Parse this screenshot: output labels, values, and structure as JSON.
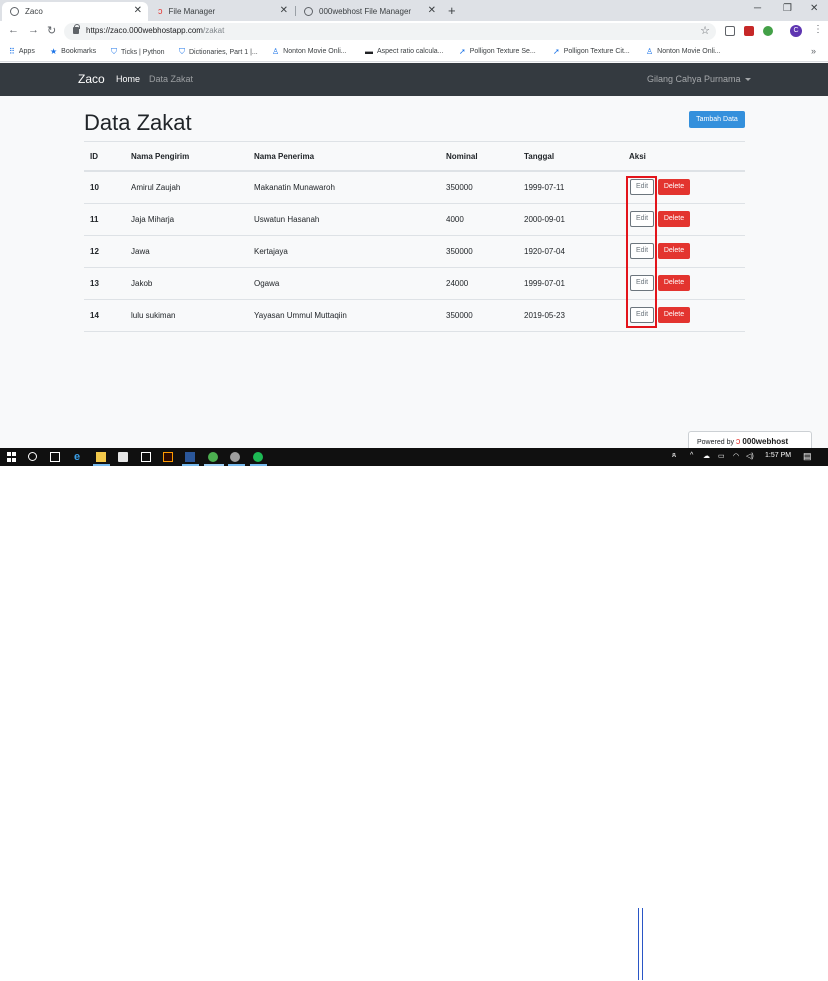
{
  "browser": {
    "tabs": [
      {
        "title": "Zaco",
        "favicon": "globe-icon",
        "active": true
      },
      {
        "title": "File Manager",
        "favicon": "webhost-icon",
        "active": false
      },
      {
        "title": "000webhost File Manager",
        "favicon": "globe-icon",
        "active": false
      }
    ],
    "url_host": "https://zaco.000webhostapp.com",
    "url_path": "/zakat",
    "bookmarks": [
      {
        "label": "Apps",
        "icon": "apps-grid-icon"
      },
      {
        "label": "Bookmarks",
        "icon": "star-icon"
      },
      {
        "label": "Ticks | Python",
        "icon": "shield-icon"
      },
      {
        "label": "Dictionaries, Part 1 |...",
        "icon": "shield-icon"
      },
      {
        "label": "Nonton Movie Onli...",
        "icon": "movie-icon"
      },
      {
        "label": "Aspect ratio calcula...",
        "icon": "calculator-icon"
      },
      {
        "label": "Polligon Texture Se...",
        "icon": "polygon-icon"
      },
      {
        "label": "Polligon Texture Cit...",
        "icon": "polygon-icon"
      },
      {
        "label": "Nonton Movie Onli...",
        "icon": "movie-icon"
      }
    ],
    "profile_initial": "C"
  },
  "site": {
    "brand": "Zaco",
    "nav": [
      {
        "label": "Home",
        "active": true
      },
      {
        "label": "Data Zakat",
        "active": false
      }
    ],
    "user": "Gilang Cahya Purnama",
    "page_title": "Data Zakat",
    "add_button": "Tambah Data",
    "table": {
      "headers": [
        "ID",
        "Nama Pengirim",
        "Nama Penerima",
        "Nominal",
        "Tanggal",
        "Aksi"
      ],
      "rows": [
        {
          "id": "10",
          "pengirim": "Amirul Zaujah",
          "penerima": "Makanatin Munawaroh",
          "nominal": "350000",
          "tanggal": "1999-07-11"
        },
        {
          "id": "11",
          "pengirim": "Jaja Miharja",
          "penerima": "Uswatun Hasanah",
          "nominal": "4000",
          "tanggal": "2000-09-01"
        },
        {
          "id": "12",
          "pengirim": "Jawa",
          "penerima": "Kertajaya",
          "nominal": "350000",
          "tanggal": "1920-07-04"
        },
        {
          "id": "13",
          "pengirim": "Jakob",
          "penerima": "Ogawa",
          "nominal": "24000",
          "tanggal": "1999-07-01"
        },
        {
          "id": "14",
          "pengirim": "lulu sukiman",
          "penerima": "Yayasan Ummul Muttaqiin",
          "nominal": "350000",
          "tanggal": "2019-05-23"
        }
      ],
      "edit_label": "Edit",
      "delete_label": "Delete"
    },
    "powered_prefix": "Powered by",
    "powered_brand": "000webhost"
  },
  "taskbar": {
    "time": "1:57 PM"
  },
  "colors": {
    "navbar": "#343a40",
    "primary": "#3490dc",
    "danger": "#e3342f",
    "highlight": "#e3141b"
  }
}
